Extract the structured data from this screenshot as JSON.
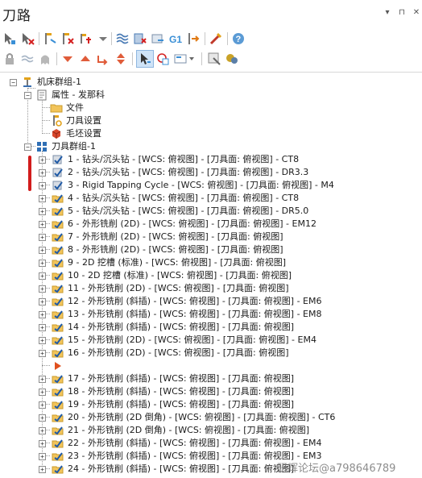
{
  "panel": {
    "title": "刀路",
    "controls": [
      "▾",
      "⊓",
      "✕"
    ]
  },
  "toolbar1_icons": [
    "select-all-operations-icon",
    "deselect-all-icon",
    "toggle-select-icon",
    "clear-selected-icon",
    "select-dirty-icon",
    "regenerate-all-icon",
    "regenerate-dirty-icon",
    "g1-post-icon",
    "move-insert-arrow-icon",
    "toolpath-edit-icon",
    "help-icon"
  ],
  "toolbar2_icons": [
    "lock-icon",
    "toggle-display-icon",
    "hide-ghost-icon",
    "move-down-icon",
    "move-up-icon",
    "move-insert-after-icon",
    "move-up-down-icon",
    "select-cursor-icon",
    "insert-position-icon",
    "display-options-icon",
    "post-selected-icon",
    "highfeed-icon"
  ],
  "tree": {
    "root": "机床群组-1",
    "properties": "属性 - 发那科",
    "files": "文件",
    "tool_settings": "刀具设置",
    "stock_setup": "毛坯设置",
    "toolpath_group": "刀具群组-1",
    "operations": [
      {
        "label": "1 - 钻头/沉头钻 - [WCS: 俯视图] - [刀具面: 俯视图] - CT8",
        "icon": "drill-op-icon"
      },
      {
        "label": "2 - 钻头/沉头钻 - [WCS: 俯视图] - [刀具面: 俯视图] - DR3.3",
        "icon": "drill-op-icon"
      },
      {
        "label": "3 - Rigid Tapping Cycle - [WCS: 俯视图] - [刀具面: 俯视图] - M4",
        "icon": "drill-op-icon"
      },
      {
        "label": "4 - 钻头/沉头钻 - [WCS: 俯视图] - [刀具面: 俯视图] - CT8",
        "icon": "folder-op-icon"
      },
      {
        "label": "5 - 钻头/沉头钻 - [WCS: 俯视图] - [刀具面: 俯视图] - DR5.0",
        "icon": "folder-op-icon"
      },
      {
        "label": "6 - 外形铣削 (2D) - [WCS: 俯视图] - [刀具面: 俯视图] - EM12",
        "icon": "folder-op-icon"
      },
      {
        "label": "7 - 外形铣削 (2D) - [WCS: 俯视图] - [刀具面: 俯视图]",
        "icon": "folder-op-icon"
      },
      {
        "label": "8 - 外形铣削 (2D) - [WCS: 俯视图] - [刀具面: 俯视图]",
        "icon": "folder-op-icon"
      },
      {
        "label": "9 - 2D 挖槽 (标准) - [WCS: 俯视图] - [刀具面: 俯视图]",
        "icon": "folder-op-icon"
      },
      {
        "label": "10 - 2D 挖槽 (标准) - [WCS: 俯视图] - [刀具面: 俯视图]",
        "icon": "folder-op-icon"
      },
      {
        "label": "11 - 外形铣削 (2D) - [WCS: 俯视图] - [刀具面: 俯视图]",
        "icon": "folder-op-icon"
      },
      {
        "label": "12 - 外形铣削 (斜插) - [WCS: 俯视图] - [刀具面: 俯视图] - EM6",
        "icon": "folder-op-icon"
      },
      {
        "label": "13 - 外形铣削 (斜插) - [WCS: 俯视图] - [刀具面: 俯视图] - EM8",
        "icon": "folder-op-icon"
      },
      {
        "label": "14 - 外形铣削 (斜插) - [WCS: 俯视图] - [刀具面: 俯视图]",
        "icon": "folder-op-icon"
      },
      {
        "label": "15 - 外形铣削 (2D) - [WCS: 俯视图] - [刀具面: 俯视图] - EM4",
        "icon": "folder-op-icon"
      },
      {
        "label": "16 - 外形铣削 (2D) - [WCS: 俯视图] - [刀具面: 俯视图]",
        "icon": "folder-op-icon"
      },
      {
        "label": "",
        "icon": "insert-arrow-icon"
      },
      {
        "label": "17 - 外形铣削 (斜插) - [WCS: 俯视图] - [刀具面: 俯视图]",
        "icon": "folder-op-icon"
      },
      {
        "label": "18 - 外形铣削 (斜插) - [WCS: 俯视图] - [刀具面: 俯视图]",
        "icon": "folder-op-icon"
      },
      {
        "label": "19 - 外形铣削 (斜插) - [WCS: 俯视图] - [刀具面: 俯视图]",
        "icon": "folder-op-icon"
      },
      {
        "label": "20 - 外形铣削 (2D 倒角) - [WCS: 俯视图] - [刀具面: 俯视图] - CT6",
        "icon": "folder-op-icon"
      },
      {
        "label": "21 - 外形铣削 (2D 倒角) - [WCS: 俯视图] - [刀具面: 俯视图]",
        "icon": "folder-op-icon"
      },
      {
        "label": "22 - 外形铣削 (斜插) - [WCS: 俯视图] - [刀具面: 俯视图] - EM4",
        "icon": "folder-op-icon"
      },
      {
        "label": "23 - 外形铣削 (斜插) - [WCS: 俯视图] - [刀具面: 俯视图] - EM3",
        "icon": "folder-op-icon"
      },
      {
        "label": "24 - 外形铣削 (斜插) - [WCS: 俯视图] - [刀具面: 俯视图]",
        "icon": "folder-op-icon"
      }
    ]
  },
  "watermark": "研辉论坛@a798646789",
  "colors": {
    "accent_red": "#d21c1c",
    "selection_blue": "#cfe3f7",
    "tree_line": "#9a9a9a"
  }
}
